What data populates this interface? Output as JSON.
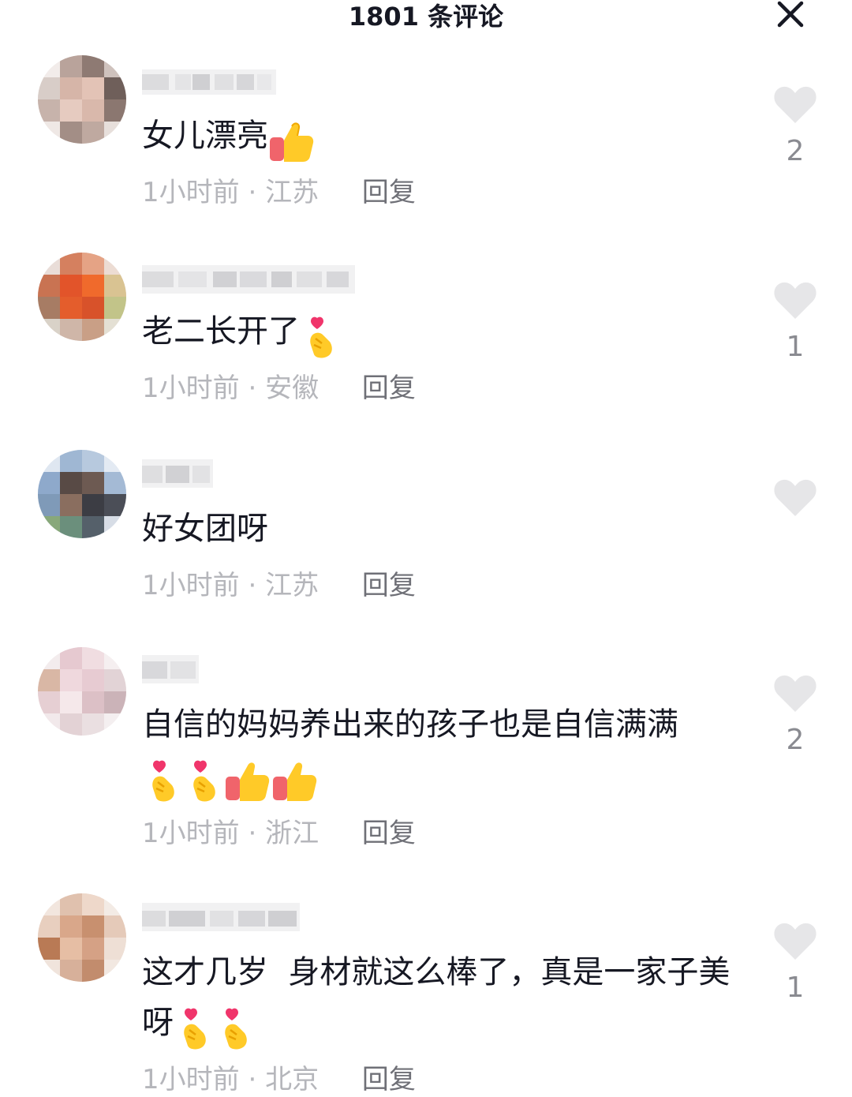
{
  "header": {
    "title": "1801 条评论",
    "close_icon": "close-icon"
  },
  "colors": {
    "text": "#161823",
    "meta": "#b5b6bb",
    "reply": "#6f7077",
    "heart": "#e6e6e8"
  },
  "comments": [
    {
      "text": "女儿漂亮",
      "emojis": [
        "thumbs-up-icon"
      ],
      "time": "1小时前",
      "sep": "·",
      "location": "江苏",
      "reply_label": "回复",
      "likes": "2"
    },
    {
      "text": "老二长开了",
      "emojis": [
        "finger-heart-icon"
      ],
      "time": "1小时前",
      "sep": "·",
      "location": "安徽",
      "reply_label": "回复",
      "likes": "1"
    },
    {
      "text": "好女团呀",
      "emojis": [],
      "time": "1小时前",
      "sep": "·",
      "location": "江苏",
      "reply_label": "回复",
      "likes": ""
    },
    {
      "text": "自信的妈妈养出来的孩子也是自信满满",
      "emojis": [
        "finger-heart-icon",
        "finger-heart-icon",
        "thumbs-up-icon",
        "thumbs-up-icon"
      ],
      "time": "1小时前",
      "sep": "·",
      "location": "浙江",
      "reply_label": "回复",
      "likes": "2"
    },
    {
      "text": "这才几岁  身材就这么棒了，真是一家子美呀",
      "emojis": [
        "finger-heart-icon",
        "finger-heart-icon"
      ],
      "time": "1小时前",
      "sep": "·",
      "location": "北京",
      "reply_label": "回复",
      "likes": "1"
    }
  ]
}
